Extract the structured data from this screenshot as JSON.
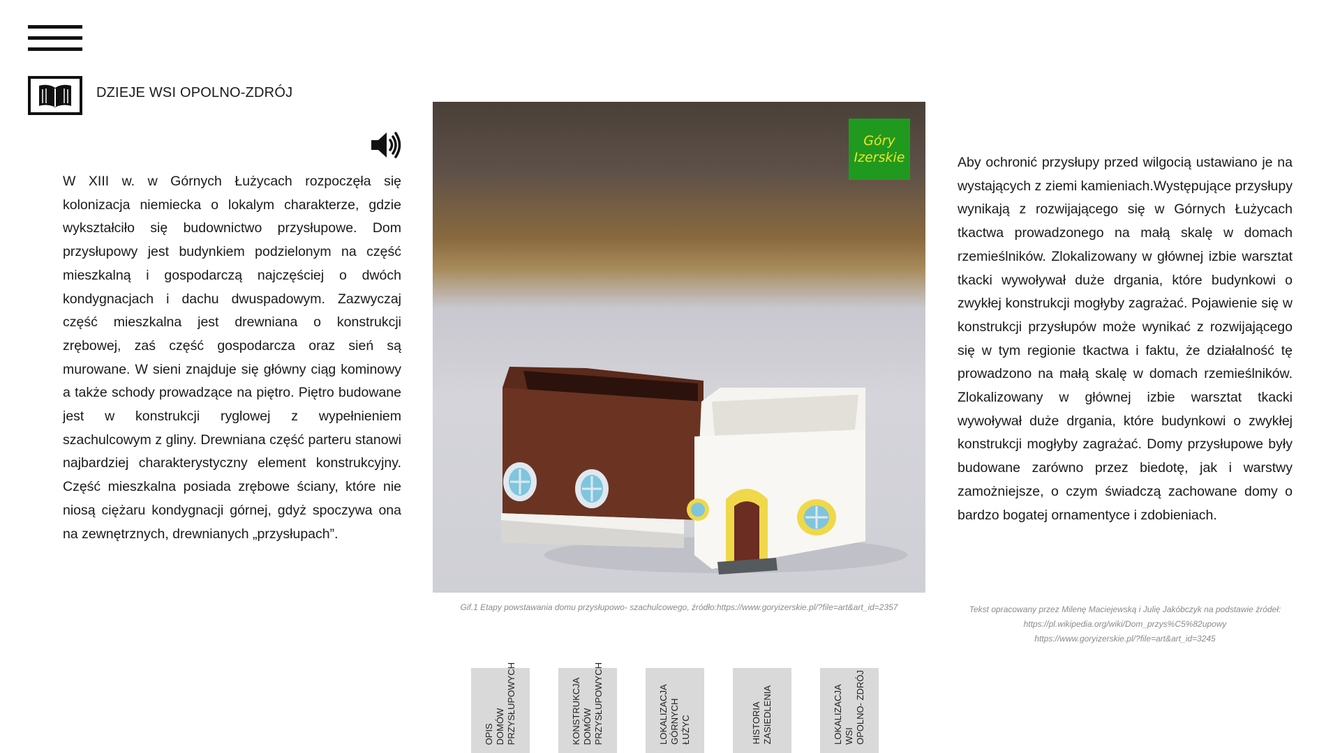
{
  "header": {
    "menu_icon": "hamburger-menu-icon",
    "book_icon": "open-book-icon",
    "title": "DZIEJE WSI OPOLNO-ZDRÓJ"
  },
  "audio": {
    "icon": "speaker-volume-icon"
  },
  "left_paragraph": "W XIII w. w Górnych Łużycach rozpoczęła się kolonizacja niemiecka o lokalym charakterze, gdzie wykształciło się budownictwo przysłupowe. Dom przysłupowy jest budynkiem podzielonym na część mieszkalną i gospodarczą najczęściej o dwóch kondygnacjach i dachu dwuspadowym. Zazwyczaj część mieszkalna jest drewniana o konstrukcji zrębowej, zaś część gospodarcza oraz sień są murowane. W sieni znajduje się główny ciąg kominowy a także schody prowadzące na piętro. Piętro budowane jest w konstrukcji ryglowej z wypełnieniem szachulcowym z gliny. Drewniana część parteru stanowi najbardziej charakterystyczny element konstrukcyjny. Część mieszkalna posiada zrębowe ściany, które nie niosą ciężaru kondygnacji górnej, gdyż spoczywa ona na zewnętrznych, drewnianych „przysłupach”.",
  "right_paragraph": "Aby ochronić przysłupy przed wilgocią ustawiano je na wystających z ziemi kamieniach.Występujące przysłupy wynikają z rozwijającego się w Górnych Łużycach tkactwa prowadzonego na małą skalę w domach rzemieślników. Zlokalizowany w głównej izbie warsztat tkacki wywoływał duże drgania, które budynkowi o zwykłej konstrukcji mogłyby zagrażać. Pojawienie się w konstrukcji przysłupów może wynikać z rozwijającego się w tym regionie tkactwa i faktu, że działalność tę prowadzono na małą skalę w domach rzemieślników. Zlokalizowany w głównej izbie warsztat tkacki wywoływał duże drgania, które budynkowi o zwykłej konstrukcji mogłyby zagrażać. Domy przysłupowe były budowane zarówno przez biedotę, jak i warstwy zamożniejsze, o czym świadczą zachowane domy o bardzo bogatej ornamentyce i zdobieniach.",
  "figure": {
    "logo_line1": "Góry",
    "logo_line2": "Izerskie",
    "caption": "Gif.1 Etapy powstawania domu przysłupowo- szachulcowego, źródło:https://www.goryizerskie.pl/?file=art&art_id=2357"
  },
  "sources": {
    "line1": "Tekst opracowany przez Milenę Maciejewską i Julię Jakóbczyk na podstawie źródeł:",
    "line2": "https://pl.wikipedia.org/wiki/Dom_przys%C5%82upowy",
    "line3": "https://www.goryizerskie.pl/?file=art&art_id=3245"
  },
  "nav_tabs": [
    {
      "label": "OPIS\nDOMÓW\nPRZYSŁUPOWYCH"
    },
    {
      "label": "KONSTRUKCJA\nDOMÓW\nPRZYSŁUPOWYCH"
    },
    {
      "label": "LOKALIZACJA\nGÓRNYCH ŁUŻYC"
    },
    {
      "label": "HISTORIA\nZASIEDLENIA"
    },
    {
      "label": "LOKALIZACJA WSI\nOPOLNO- ZDRÓJ"
    }
  ]
}
